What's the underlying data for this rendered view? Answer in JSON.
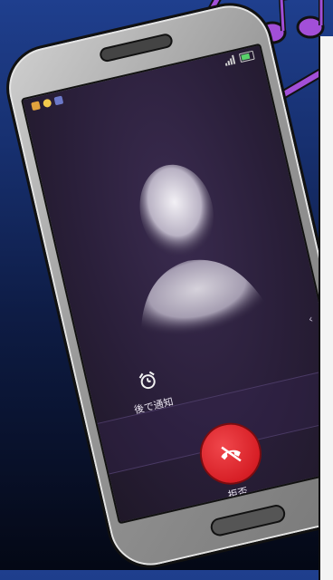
{
  "status_bar": {
    "notification_icons": [
      "missed-call-icon",
      "smiley-icon",
      "message-icon"
    ],
    "clock": "",
    "signal_icon": "signal-bars-icon",
    "battery_icon": "battery-icon"
  },
  "caller": {
    "number": "",
    "avatar_icon": "person-silhouette-icon"
  },
  "actions": {
    "snooze": {
      "icon": "alarm-clock-icon",
      "label": "後で通知"
    },
    "decline": {
      "icon": "phone-hangup-icon",
      "label": "拒否",
      "color": "#e0282e"
    }
  },
  "colors": {
    "screen_bg": "#2a1f3a",
    "accent_line": "#2d8fd8",
    "music_notes": "#a24fd8"
  }
}
